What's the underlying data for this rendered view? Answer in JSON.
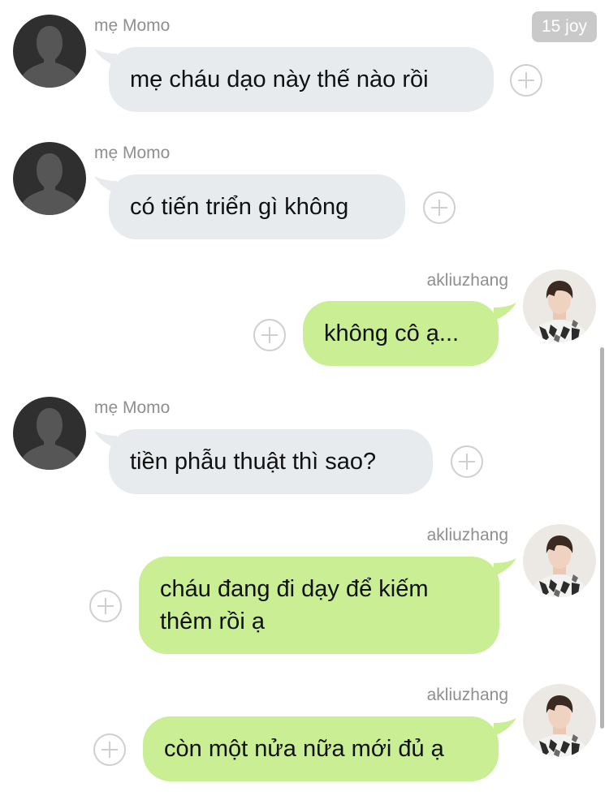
{
  "header": {
    "badge": "15 joy"
  },
  "colors": {
    "incoming": "#e7ebee",
    "outgoing": "#c9ee93",
    "badge": "#c9c9c9"
  },
  "messages": [
    {
      "sender": "mẹ Momo",
      "text": "mẹ cháu dạo này thế nào rồi",
      "direction": "incoming",
      "avatar_icon": "default-person-icon"
    },
    {
      "sender": "mẹ Momo",
      "text": "có tiến triển gì không",
      "direction": "incoming",
      "avatar_icon": "default-person-icon"
    },
    {
      "sender": "akliuzhang",
      "text": "không cô ạ...",
      "direction": "outgoing",
      "avatar_icon": "profile-photo"
    },
    {
      "sender": "mẹ Momo",
      "text": "tiền phẫu thuật thì sao?",
      "direction": "incoming",
      "avatar_icon": "default-person-icon"
    },
    {
      "sender": "akliuzhang",
      "text": "cháu đang đi dạy để kiếm thêm rồi ạ",
      "direction": "outgoing",
      "avatar_icon": "profile-photo"
    },
    {
      "sender": "akliuzhang",
      "text": "còn một nửa nữa mới đủ ạ",
      "direction": "outgoing",
      "avatar_icon": "profile-photo"
    }
  ]
}
